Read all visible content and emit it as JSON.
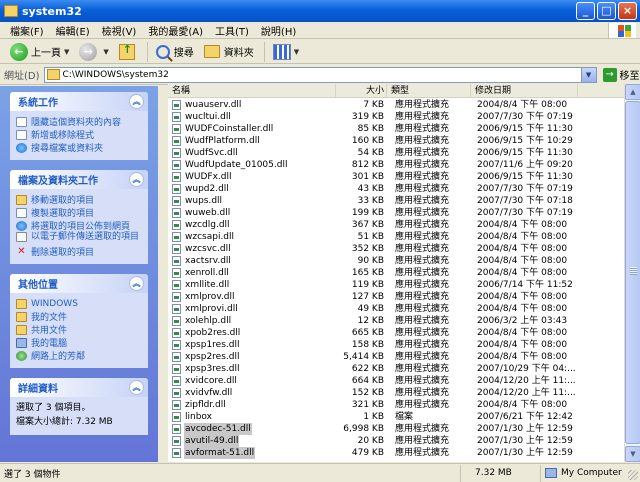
{
  "window": {
    "title": "system32"
  },
  "menu": [
    "檔案(F)",
    "編輯(E)",
    "檢視(V)",
    "我的最愛(A)",
    "工具(T)",
    "說明(H)"
  ],
  "toolbar": {
    "back_label": "上一頁",
    "search_label": "搜尋",
    "folders_label": "資料夾"
  },
  "address": {
    "label": "網址(D)",
    "value": "C:\\WINDOWS\\system32",
    "go_label": "移至"
  },
  "taskpane": {
    "system_tasks": {
      "title": "系統工作",
      "items": [
        "隱藏這個資料夾的內容",
        "新增或移除程式",
        "搜尋檔案或資料夾"
      ]
    },
    "file_tasks": {
      "title": "檔案及資料夾工作",
      "items": [
        "移動選取的項目",
        "複製選取的項目",
        "將選取的項目公佈到網頁",
        "以電子郵件傳送選取的項目",
        "刪除選取的項目"
      ]
    },
    "other_places": {
      "title": "其他位置",
      "items": [
        "WINDOWS",
        "我的文件",
        "共用文件",
        "我的電腦",
        "網路上的芳鄰"
      ]
    },
    "details": {
      "title": "詳細資料",
      "line1": "選取了 3 個項目。",
      "line2": "檔案大小總計: 7.32 MB"
    }
  },
  "columns": {
    "name": "名稱",
    "size": "大小",
    "type": "類型",
    "date": "修改日期"
  },
  "files": [
    {
      "name": "wuauserv.dll",
      "size": "7 KB",
      "type": "應用程式擴充",
      "date": "2004/8/4 下午 08:00",
      "selected": false
    },
    {
      "name": "wucltui.dll",
      "size": "319 KB",
      "type": "應用程式擴充",
      "date": "2007/7/30 下午 07:19",
      "selected": false
    },
    {
      "name": "WUDFCoinstaller.dll",
      "size": "85 KB",
      "type": "應用程式擴充",
      "date": "2006/9/15 下午 11:30",
      "selected": false
    },
    {
      "name": "WudfPlatform.dll",
      "size": "160 KB",
      "type": "應用程式擴充",
      "date": "2006/9/15 下午 10:29",
      "selected": false
    },
    {
      "name": "WudfSvc.dll",
      "size": "54 KB",
      "type": "應用程式擴充",
      "date": "2006/9/15 下午 11:30",
      "selected": false
    },
    {
      "name": "WudfUpdate_01005.dll",
      "size": "812 KB",
      "type": "應用程式擴充",
      "date": "2007/11/6 上午 09:20",
      "selected": false
    },
    {
      "name": "WUDFx.dll",
      "size": "301 KB",
      "type": "應用程式擴充",
      "date": "2006/9/15 下午 11:30",
      "selected": false
    },
    {
      "name": "wupd2.dll",
      "size": "43 KB",
      "type": "應用程式擴充",
      "date": "2007/7/30 下午 07:19",
      "selected": false
    },
    {
      "name": "wups.dll",
      "size": "33 KB",
      "type": "應用程式擴充",
      "date": "2007/7/30 下午 07:18",
      "selected": false
    },
    {
      "name": "wuweb.dll",
      "size": "199 KB",
      "type": "應用程式擴充",
      "date": "2007/7/30 下午 07:19",
      "selected": false
    },
    {
      "name": "wzcdlg.dll",
      "size": "367 KB",
      "type": "應用程式擴充",
      "date": "2004/8/4 下午 08:00",
      "selected": false
    },
    {
      "name": "wzcsapi.dll",
      "size": "51 KB",
      "type": "應用程式擴充",
      "date": "2004/8/4 下午 08:00",
      "selected": false
    },
    {
      "name": "wzcsvc.dll",
      "size": "352 KB",
      "type": "應用程式擴充",
      "date": "2004/8/4 下午 08:00",
      "selected": false
    },
    {
      "name": "xactsrv.dll",
      "size": "90 KB",
      "type": "應用程式擴充",
      "date": "2004/8/4 下午 08:00",
      "selected": false
    },
    {
      "name": "xenroll.dll",
      "size": "165 KB",
      "type": "應用程式擴充",
      "date": "2004/8/4 下午 08:00",
      "selected": false
    },
    {
      "name": "xmllite.dll",
      "size": "119 KB",
      "type": "應用程式擴充",
      "date": "2006/7/14 下午 11:52",
      "selected": false
    },
    {
      "name": "xmlprov.dll",
      "size": "127 KB",
      "type": "應用程式擴充",
      "date": "2004/8/4 下午 08:00",
      "selected": false
    },
    {
      "name": "xmlprovi.dll",
      "size": "49 KB",
      "type": "應用程式擴充",
      "date": "2004/8/4 下午 08:00",
      "selected": false
    },
    {
      "name": "xolehlp.dll",
      "size": "12 KB",
      "type": "應用程式擴充",
      "date": "2006/3/2 上午 03:43",
      "selected": false
    },
    {
      "name": "xpob2res.dll",
      "size": "665 KB",
      "type": "應用程式擴充",
      "date": "2004/8/4 下午 08:00",
      "selected": false
    },
    {
      "name": "xpsp1res.dll",
      "size": "158 KB",
      "type": "應用程式擴充",
      "date": "2004/8/4 下午 08:00",
      "selected": false
    },
    {
      "name": "xpsp2res.dll",
      "size": "5,414 KB",
      "type": "應用程式擴充",
      "date": "2004/8/4 下午 08:00",
      "selected": false
    },
    {
      "name": "xpsp3res.dll",
      "size": "622 KB",
      "type": "應用程式擴充",
      "date": "2007/10/29 下午 04:...",
      "selected": false
    },
    {
      "name": "xvidcore.dll",
      "size": "664 KB",
      "type": "應用程式擴充",
      "date": "2004/12/20 上午 11:...",
      "selected": false
    },
    {
      "name": "xvidvfw.dll",
      "size": "152 KB",
      "type": "應用程式擴充",
      "date": "2004/12/20 上午 11:...",
      "selected": false
    },
    {
      "name": "zipfldr.dll",
      "size": "321 KB",
      "type": "應用程式擴充",
      "date": "2004/8/4 下午 08:00",
      "selected": false
    },
    {
      "name": "linbox",
      "size": "1 KB",
      "type": "檔案",
      "date": "2007/6/21 下午 12:42",
      "selected": false
    },
    {
      "name": "avcodec-51.dll",
      "size": "6,998 KB",
      "type": "應用程式擴充",
      "date": "2007/1/30 上午 12:59",
      "selected": true
    },
    {
      "name": "avutil-49.dll",
      "size": "20 KB",
      "type": "應用程式擴充",
      "date": "2007/1/30 上午 12:59",
      "selected": true
    },
    {
      "name": "avformat-51.dll",
      "size": "479 KB",
      "type": "應用程式擴充",
      "date": "2007/1/30 上午 12:59",
      "selected": true
    }
  ],
  "status": {
    "left": "選了 3 個物件",
    "size": "7.32 MB",
    "location": "My Computer"
  }
}
